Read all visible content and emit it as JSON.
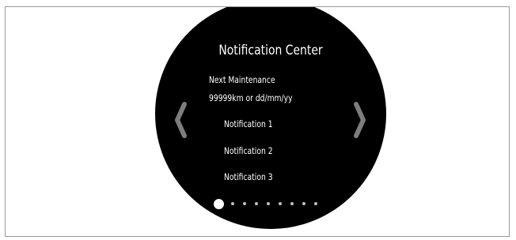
{
  "screen": {
    "title": "Notification Center",
    "maintenance": {
      "label": "Next Maintenance",
      "value": "99999km or dd/mm/yy"
    },
    "notifications": [
      {
        "label": "Notification 1"
      },
      {
        "label": "Notification 2"
      },
      {
        "label": "Notification 3"
      }
    ],
    "pager": {
      "total_pages": 9,
      "current_page": 1
    },
    "icons": {
      "prev": "chevron-left-icon",
      "next": "chevron-right-icon"
    }
  }
}
